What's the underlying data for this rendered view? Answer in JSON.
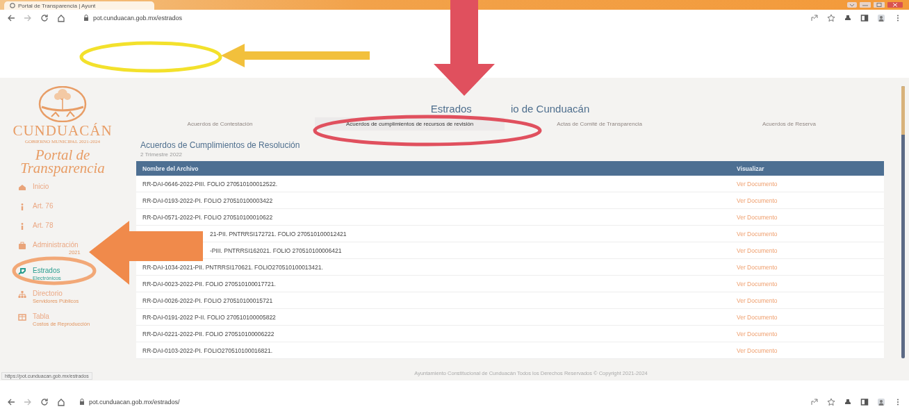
{
  "browser": {
    "tab_title": "Portal de Transparencia | Ayunt",
    "address": "pot.cunduacan.gob.mx/estrados",
    "status_url": "https://pot.cunduacan.gob.mx/estrados",
    "bottom_address": "pot.cunduacan.gob.mx/estrados/"
  },
  "logo": {
    "name": "CUNDUACÁN",
    "tagline": "GOBIERNO MUNICIPAL 2021-2024",
    "portal": "Portal de Transparencia"
  },
  "sidebar": {
    "items": [
      {
        "label": "Inicio",
        "selected": false
      },
      {
        "label": "Art. 76",
        "selected": false
      },
      {
        "label": "Art. 78",
        "selected": false
      },
      {
        "label": "Administración",
        "sublabel": "2021",
        "selected": false
      },
      {
        "label": "Estrados",
        "sublabel": "Electrónicos",
        "selected": true
      },
      {
        "label": "Directorio",
        "sublabel": "Servidores Públicos",
        "selected": false
      },
      {
        "label": "Tabla",
        "sublabel": "Costos de Reproducción",
        "selected": false
      }
    ]
  },
  "header": {
    "title_start": "Estrados",
    "title_end": "io de Cunduacán"
  },
  "tabs": [
    {
      "label": "Acuerdos de Contestación",
      "selected": false
    },
    {
      "label": "Acuerdos de cumplimientos de recursos de revisión",
      "selected": true
    },
    {
      "label": "Actas de Comité de Transparencia",
      "selected": false
    },
    {
      "label": "Acuerdos de Reserva",
      "selected": false
    }
  ],
  "section": {
    "title": "Acuerdos de Cumplimientos de Resolución",
    "subtitle": "2 Trimestre 2022"
  },
  "table": {
    "columns": [
      "Nombre del Archivo",
      "Visualizar"
    ],
    "rows": [
      [
        "RR-DAI-0646-2022-PIII. FOLIO 270510100012522.",
        "Ver Documento"
      ],
      [
        "RR-DAI-0193-2022-PI. FOLIO 270510100003422",
        "Ver Documento"
      ],
      [
        "RR-DAI-0571-2022-PI. FOLIO 270510100010622",
        "Ver Documento"
      ],
      [
        "21-PII. PNTRRSI172721. FOLIO 270510100012421",
        "Ver Documento"
      ],
      [
        "-PIII. PNTRRSI162021. FOLIO 270510100006421",
        "Ver Documento"
      ],
      [
        "RR-DAI-1034-2021-PII. PNTRRSI170621. FOLIO270510100013421.",
        "Ver Documento"
      ],
      [
        "RR-DAI-0023-2022-PII. FOLIO 270510100017721.",
        "Ver Documento"
      ],
      [
        "RR-DAI-0026-2022-PI. FOLIO 270510100015721",
        "Ver Documento"
      ],
      [
        "RR-DAI-0191-2022 P-II. FOLIO 270510100005822",
        "Ver Documento"
      ],
      [
        "RR-DAI-0221-2022-PII. FOLIO 270510100006222",
        "Ver Documento"
      ],
      [
        "RR-DAI-0103-2022-PI. FOLIO270510100016821.",
        "Ver Documento"
      ]
    ]
  },
  "footer": "Ayuntamiento Constitucional de Cunduacán Todos los Derechos Reservados © Copyright 2021-2024",
  "annotations": [
    {
      "kind": "ellipse",
      "color": "#f3e12c"
    },
    {
      "kind": "arrow",
      "color": "#f2c03c"
    },
    {
      "kind": "arrow",
      "color": "#e0505e"
    },
    {
      "kind": "ellipse",
      "color": "#e0505e"
    },
    {
      "kind": "arrow",
      "color": "#f08a4b"
    },
    {
      "kind": "ellipse",
      "color": "#f2a877"
    }
  ]
}
